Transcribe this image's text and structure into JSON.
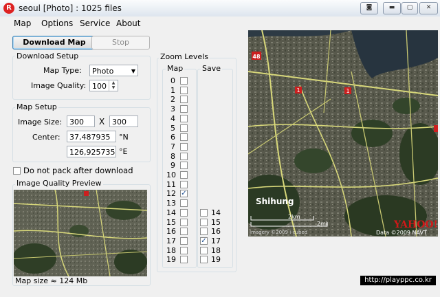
{
  "window": {
    "title": "seoul [Photo] : 1025 files",
    "app_icon_glyph": "R"
  },
  "menu": [
    "Map",
    "Options",
    "Service",
    "About"
  ],
  "toolbar": {
    "download_label": "Download Map",
    "stop_label": "Stop"
  },
  "download_setup": {
    "title": "Download Setup",
    "map_type_label": "Map Type:",
    "map_type_value": "Photo",
    "image_quality_label": "Image Quality:",
    "image_quality_value": "100"
  },
  "map_setup": {
    "title": "Map Setup",
    "image_size_label": "Image Size:",
    "width": "300",
    "x_sep": "X",
    "height": "300",
    "center_label": "Center:",
    "lat": "37,487935",
    "lat_unit": "°N",
    "lon": "126,925735",
    "lon_unit": "°E"
  },
  "options": {
    "no_pack_label": "Do not pack after download"
  },
  "preview": {
    "title": "Image Quality Preview",
    "map_size": "Map size ≈ 124 Mb"
  },
  "zoom": {
    "title": "Zoom Levels",
    "map_col": "Map",
    "save_col": "Save",
    "map_levels": [
      "0",
      "1",
      "2",
      "3",
      "4",
      "5",
      "6",
      "7",
      "8",
      "9",
      "10",
      "11",
      "12",
      "13",
      "14",
      "15",
      "16",
      "17",
      "18",
      "19"
    ],
    "map_checked": [
      "12"
    ],
    "save_levels": [
      "14",
      "15",
      "16",
      "17",
      "18",
      "19"
    ],
    "save_checked": [
      "17"
    ]
  },
  "map_view": {
    "city_label": "Shihung",
    "scale_km": "2km",
    "scale_mi": "2mi",
    "copyright": "Data ©2009 NAVT",
    "brand": "YAHOO!",
    "imagery": "Imagery ©2009 i-cubed",
    "route_shield_48": "48",
    "route_shield_1": "1"
  },
  "watermark": "http://playppc.co.kr",
  "colors": {
    "accent": "#1d4f91",
    "map_road": "#d8d87a",
    "shield_red": "#cc1f1f"
  }
}
